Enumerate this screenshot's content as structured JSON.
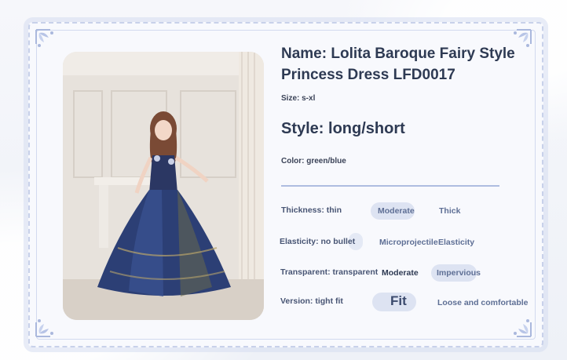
{
  "product": {
    "title_line1": "Name: Lolita Baroque Fairy Style",
    "title_line2": "Princess Dress LFD0017",
    "size": "Size: s-xl",
    "style": "Style: long/short",
    "color": "Color: green/blue"
  },
  "attributes": {
    "thickness": {
      "label": "Thickness: thin",
      "options": [
        "Moderate",
        "Thick"
      ],
      "selected": "Moderate"
    },
    "elasticity": {
      "label": "Elasticity: no bullet",
      "options": [
        "Microprojectile",
        "Elasticity"
      ]
    },
    "transparent": {
      "label": "Transparent: transparent",
      "options": [
        "Moderate",
        "Impervious"
      ],
      "selected": "Impervious"
    },
    "version": {
      "label": "Version: tight fit",
      "options": [
        "Fit",
        "Loose and comfortable"
      ],
      "selected": "Fit"
    }
  },
  "colors": {
    "accent": "#2e3a53",
    "pill": "#dde3f2",
    "frame": "#c8d1ea",
    "dress": "#2c3f75"
  },
  "icons": [
    "corner-ornament-icon"
  ]
}
